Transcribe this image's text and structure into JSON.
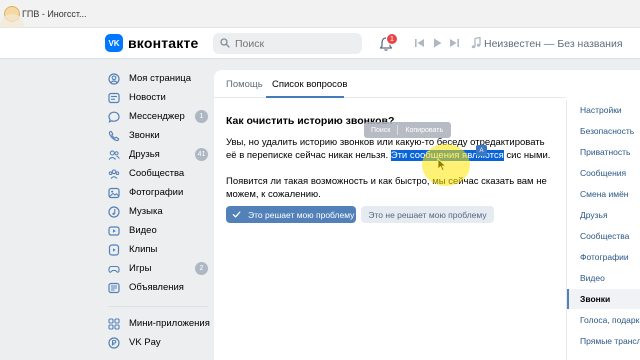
{
  "browser": {
    "tab_title": "ГПВ - Иногсст..."
  },
  "header": {
    "logo_badge": "VK",
    "logo_text": "вконтакте",
    "search_placeholder": "Поиск",
    "notifications_count": "1",
    "music_title": "Неизвестен — Без названия"
  },
  "sidebar": {
    "items": [
      {
        "label": "Моя страница",
        "icon": "user-icon",
        "count": ""
      },
      {
        "label": "Новости",
        "icon": "news-icon",
        "count": ""
      },
      {
        "label": "Мессенджер",
        "icon": "chat-icon",
        "count": "1"
      },
      {
        "label": "Звонки",
        "icon": "phone-icon",
        "count": ""
      },
      {
        "label": "Друзья",
        "icon": "friends-icon",
        "count": "41"
      },
      {
        "label": "Сообщества",
        "icon": "groups-icon",
        "count": ""
      },
      {
        "label": "Фотографии",
        "icon": "photo-icon",
        "count": ""
      },
      {
        "label": "Музыка",
        "icon": "music-icon",
        "count": ""
      },
      {
        "label": "Видео",
        "icon": "video-icon",
        "count": ""
      },
      {
        "label": "Клипы",
        "icon": "clips-icon",
        "count": ""
      },
      {
        "label": "Игры",
        "icon": "games-icon",
        "count": "2"
      },
      {
        "label": "Объявления",
        "icon": "ads-icon",
        "count": ""
      }
    ],
    "extra": [
      {
        "label": "Мини-приложения",
        "icon": "apps-icon"
      },
      {
        "label": "VK Pay",
        "icon": "pay-icon"
      }
    ]
  },
  "main": {
    "tabs": [
      {
        "label": "Помощь"
      },
      {
        "label": "Список вопросов"
      }
    ],
    "question_title": "Как очистить историю звонков?",
    "answer_line1": "Увы, но удалить историю звонков или какую-то беседу отредактировать её в",
    "answer_line2_before": "переписке сейчас никак нельзя. ",
    "answer_highlight": "Эти сообщения являются",
    "answer_line2_after": " сис   ными.",
    "answer_para2": "Появится ли такая возможность и как быстро, мы сейчас сказать вам не можем, к сожалению.",
    "context_search": "Поиск",
    "context_copy": "Копировать",
    "translate_badge": "A",
    "btn_solved": "Это решает мою проблему",
    "btn_not_solved": "Это не решает мою проблему"
  },
  "right_nav": {
    "items": [
      {
        "label": "Настройки",
        "active": false
      },
      {
        "label": "Безопасность",
        "active": false
      },
      {
        "label": "Приватность",
        "active": false
      },
      {
        "label": "Сообщения",
        "active": false
      },
      {
        "label": "Смена имён",
        "active": false
      },
      {
        "label": "Друзья",
        "active": false
      },
      {
        "label": "Сообщества",
        "active": false
      },
      {
        "label": "Фотографии",
        "active": false
      },
      {
        "label": "Видео",
        "active": false
      },
      {
        "label": "Звонки",
        "active": true
      },
      {
        "label": "Голоса, подарки",
        "active": false
      },
      {
        "label": "Прямые трансл",
        "active": false
      }
    ]
  },
  "colors": {
    "accent": "#5181b8",
    "vk_blue": "#0077ff",
    "badge_red": "#e64646",
    "highlight": "#0a64d9"
  }
}
